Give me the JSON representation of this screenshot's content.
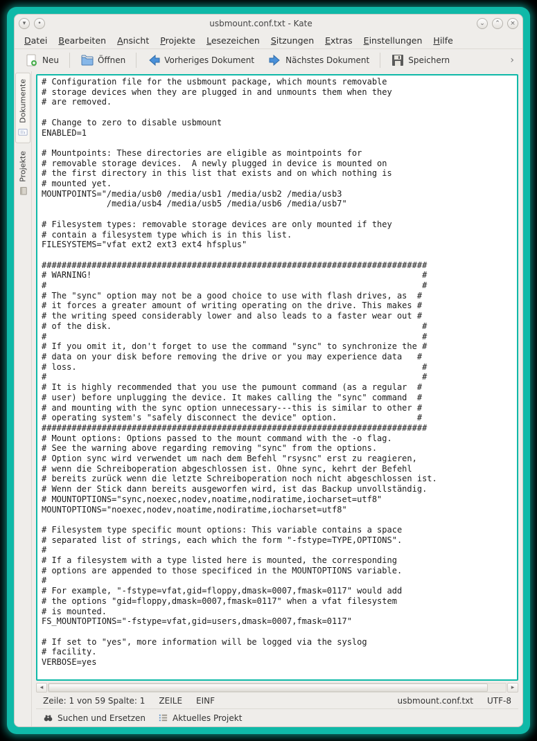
{
  "title": "usbmount.conf.txt - Kate",
  "menubar": {
    "file": {
      "label": "Datei",
      "accel": "D"
    },
    "edit": {
      "label": "Bearbeiten",
      "accel": "B"
    },
    "view": {
      "label": "Ansicht",
      "accel": "A"
    },
    "projects": {
      "label": "Projekte",
      "accel": "P"
    },
    "bookmarks": {
      "label": "Lesezeichen",
      "accel": "L"
    },
    "sessions": {
      "label": "Sitzungen",
      "accel": "S"
    },
    "extras": {
      "label": "Extras",
      "accel": "E"
    },
    "settings": {
      "label": "Einstellungen",
      "accel": "E"
    },
    "help": {
      "label": "Hilfe",
      "accel": "H"
    }
  },
  "toolbar": {
    "new": "Neu",
    "open": "Öffnen",
    "prev": "Vorheriges Dokument",
    "next": "Nächstes Dokument",
    "save": "Speichern"
  },
  "sidetabs": {
    "documents": "Dokumente",
    "projects": "Projekte"
  },
  "editor_text": "# Configuration file for the usbmount package, which mounts removable\n# storage devices when they are plugged in and unmounts them when they\n# are removed.\n\n# Change to zero to disable usbmount\nENABLED=1\n\n# Mountpoints: These directories are eligible as mointpoints for\n# removable storage devices.  A newly plugged in device is mounted on\n# the first directory in this list that exists and on which nothing is\n# mounted yet.\nMOUNTPOINTS=\"/media/usb0 /media/usb1 /media/usb2 /media/usb3\n             /media/usb4 /media/usb5 /media/usb6 /media/usb7\"\n\n# Filesystem types: removable storage devices are only mounted if they\n# contain a filesystem type which is in this list.\nFILESYSTEMS=\"vfat ext2 ext3 ext4 hfsplus\"\n\n#############################################################################\n# WARNING!                                                                  #\n#                                                                           #\n# The \"sync\" option may not be a good choice to use with flash drives, as  #\n# it forces a greater amount of writing operating on the drive. This makes #\n# the writing speed considerably lower and also leads to a faster wear out #\n# of the disk.                                                              #\n#                                                                           #\n# If you omit it, don't forget to use the command \"sync\" to synchronize the #\n# data on your disk before removing the drive or you may experience data   #\n# loss.                                                                     #\n#                                                                           #\n# It is highly recommended that you use the pumount command (as a regular  #\n# user) before unplugging the device. It makes calling the \"sync\" command  #\n# and mounting with the sync option unnecessary---this is similar to other #\n# operating system's \"safely disconnect the device\" option.                #\n#############################################################################\n# Mount options: Options passed to the mount command with the -o flag.\n# See the warning above regarding removing \"sync\" from the options.\n# Option sync wird verwendet um nach dem Befehl \"rsysnc\" erst zu reagieren,\n# wenn die Schreiboperation abgeschlossen ist. Ohne sync, kehrt der Befehl\n# bereits zurück wenn die letzte Schreiboperation noch nicht abgeschlossen ist.\n# Wenn der Stick dann bereits ausgeworfen wird, ist das Backup unvollständig.\n# MOUNTOPTIONS=\"sync,noexec,nodev,noatime,nodiratime,iocharset=utf8\"\nMOUNTOPTIONS=\"noexec,nodev,noatime,nodiratime,iocharset=utf8\"\n\n# Filesystem type specific mount options: This variable contains a space\n# separated list of strings, each which the form \"-fstype=TYPE,OPTIONS\".\n#\n# If a filesystem with a type listed here is mounted, the corresponding\n# options are appended to those specificed in the MOUNTOPTIONS variable.\n#\n# For example, \"-fstype=vfat,gid=floppy,dmask=0007,fmask=0117\" would add\n# the options \"gid=floppy,dmask=0007,fmask=0117\" when a vfat filesystem\n# is mounted.\nFS_MOUNTOPTIONS=\"-fstype=vfat,gid=users,dmask=0007,fmask=0117\"\n\n# If set to \"yes\", more information will be logged via the syslog\n# facility.\nVERBOSE=yes\n",
  "status": {
    "pos": "Zeile: 1 von 59 Spalte: 1",
    "wrap": "ZEILE",
    "ins": "EINF",
    "file": "usbmount.conf.txt",
    "enc": "UTF-8"
  },
  "bottombar": {
    "search": "Suchen und Ersetzen",
    "project": "Aktuelles Projekt"
  }
}
